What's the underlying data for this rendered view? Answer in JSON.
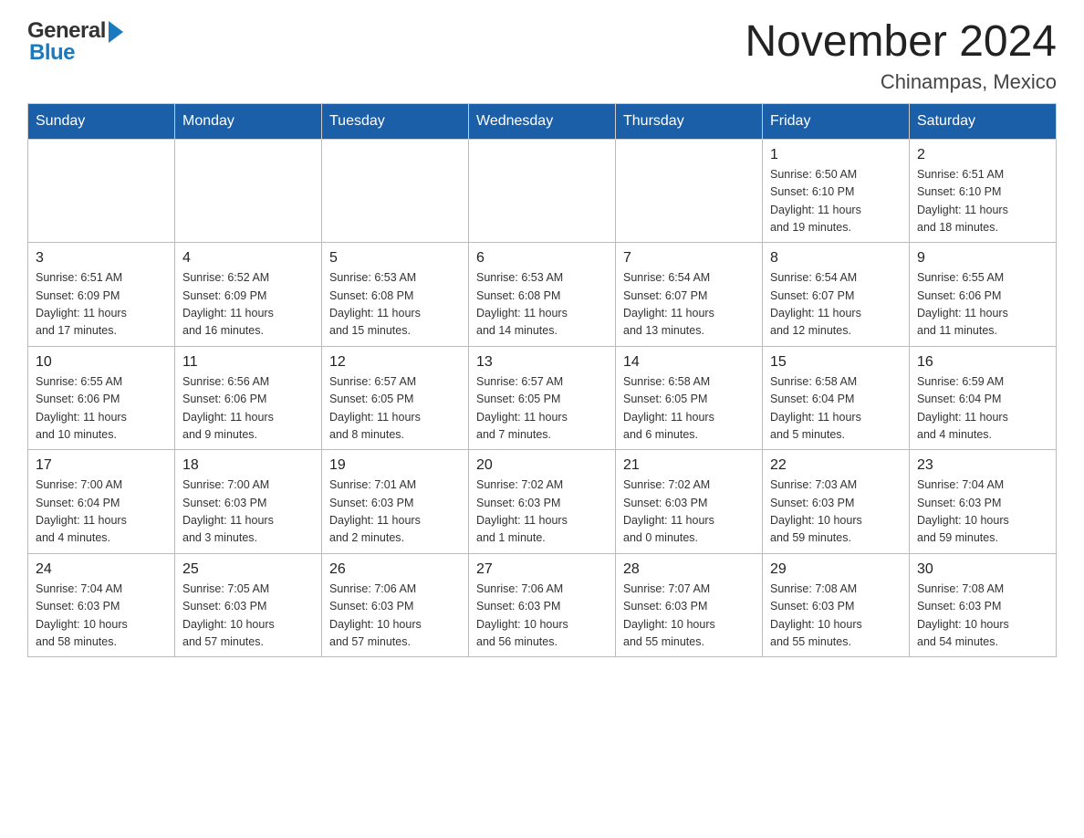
{
  "header": {
    "title": "November 2024",
    "subtitle": "Chinampas, Mexico",
    "logo_general": "General",
    "logo_blue": "Blue"
  },
  "weekdays": [
    "Sunday",
    "Monday",
    "Tuesday",
    "Wednesday",
    "Thursday",
    "Friday",
    "Saturday"
  ],
  "weeks": [
    [
      {
        "day": "",
        "info": ""
      },
      {
        "day": "",
        "info": ""
      },
      {
        "day": "",
        "info": ""
      },
      {
        "day": "",
        "info": ""
      },
      {
        "day": "",
        "info": ""
      },
      {
        "day": "1",
        "info": "Sunrise: 6:50 AM\nSunset: 6:10 PM\nDaylight: 11 hours\nand 19 minutes."
      },
      {
        "day": "2",
        "info": "Sunrise: 6:51 AM\nSunset: 6:10 PM\nDaylight: 11 hours\nand 18 minutes."
      }
    ],
    [
      {
        "day": "3",
        "info": "Sunrise: 6:51 AM\nSunset: 6:09 PM\nDaylight: 11 hours\nand 17 minutes."
      },
      {
        "day": "4",
        "info": "Sunrise: 6:52 AM\nSunset: 6:09 PM\nDaylight: 11 hours\nand 16 minutes."
      },
      {
        "day": "5",
        "info": "Sunrise: 6:53 AM\nSunset: 6:08 PM\nDaylight: 11 hours\nand 15 minutes."
      },
      {
        "day": "6",
        "info": "Sunrise: 6:53 AM\nSunset: 6:08 PM\nDaylight: 11 hours\nand 14 minutes."
      },
      {
        "day": "7",
        "info": "Sunrise: 6:54 AM\nSunset: 6:07 PM\nDaylight: 11 hours\nand 13 minutes."
      },
      {
        "day": "8",
        "info": "Sunrise: 6:54 AM\nSunset: 6:07 PM\nDaylight: 11 hours\nand 12 minutes."
      },
      {
        "day": "9",
        "info": "Sunrise: 6:55 AM\nSunset: 6:06 PM\nDaylight: 11 hours\nand 11 minutes."
      }
    ],
    [
      {
        "day": "10",
        "info": "Sunrise: 6:55 AM\nSunset: 6:06 PM\nDaylight: 11 hours\nand 10 minutes."
      },
      {
        "day": "11",
        "info": "Sunrise: 6:56 AM\nSunset: 6:06 PM\nDaylight: 11 hours\nand 9 minutes."
      },
      {
        "day": "12",
        "info": "Sunrise: 6:57 AM\nSunset: 6:05 PM\nDaylight: 11 hours\nand 8 minutes."
      },
      {
        "day": "13",
        "info": "Sunrise: 6:57 AM\nSunset: 6:05 PM\nDaylight: 11 hours\nand 7 minutes."
      },
      {
        "day": "14",
        "info": "Sunrise: 6:58 AM\nSunset: 6:05 PM\nDaylight: 11 hours\nand 6 minutes."
      },
      {
        "day": "15",
        "info": "Sunrise: 6:58 AM\nSunset: 6:04 PM\nDaylight: 11 hours\nand 5 minutes."
      },
      {
        "day": "16",
        "info": "Sunrise: 6:59 AM\nSunset: 6:04 PM\nDaylight: 11 hours\nand 4 minutes."
      }
    ],
    [
      {
        "day": "17",
        "info": "Sunrise: 7:00 AM\nSunset: 6:04 PM\nDaylight: 11 hours\nand 4 minutes."
      },
      {
        "day": "18",
        "info": "Sunrise: 7:00 AM\nSunset: 6:03 PM\nDaylight: 11 hours\nand 3 minutes."
      },
      {
        "day": "19",
        "info": "Sunrise: 7:01 AM\nSunset: 6:03 PM\nDaylight: 11 hours\nand 2 minutes."
      },
      {
        "day": "20",
        "info": "Sunrise: 7:02 AM\nSunset: 6:03 PM\nDaylight: 11 hours\nand 1 minute."
      },
      {
        "day": "21",
        "info": "Sunrise: 7:02 AM\nSunset: 6:03 PM\nDaylight: 11 hours\nand 0 minutes."
      },
      {
        "day": "22",
        "info": "Sunrise: 7:03 AM\nSunset: 6:03 PM\nDaylight: 10 hours\nand 59 minutes."
      },
      {
        "day": "23",
        "info": "Sunrise: 7:04 AM\nSunset: 6:03 PM\nDaylight: 10 hours\nand 59 minutes."
      }
    ],
    [
      {
        "day": "24",
        "info": "Sunrise: 7:04 AM\nSunset: 6:03 PM\nDaylight: 10 hours\nand 58 minutes."
      },
      {
        "day": "25",
        "info": "Sunrise: 7:05 AM\nSunset: 6:03 PM\nDaylight: 10 hours\nand 57 minutes."
      },
      {
        "day": "26",
        "info": "Sunrise: 7:06 AM\nSunset: 6:03 PM\nDaylight: 10 hours\nand 57 minutes."
      },
      {
        "day": "27",
        "info": "Sunrise: 7:06 AM\nSunset: 6:03 PM\nDaylight: 10 hours\nand 56 minutes."
      },
      {
        "day": "28",
        "info": "Sunrise: 7:07 AM\nSunset: 6:03 PM\nDaylight: 10 hours\nand 55 minutes."
      },
      {
        "day": "29",
        "info": "Sunrise: 7:08 AM\nSunset: 6:03 PM\nDaylight: 10 hours\nand 55 minutes."
      },
      {
        "day": "30",
        "info": "Sunrise: 7:08 AM\nSunset: 6:03 PM\nDaylight: 10 hours\nand 54 minutes."
      }
    ]
  ]
}
